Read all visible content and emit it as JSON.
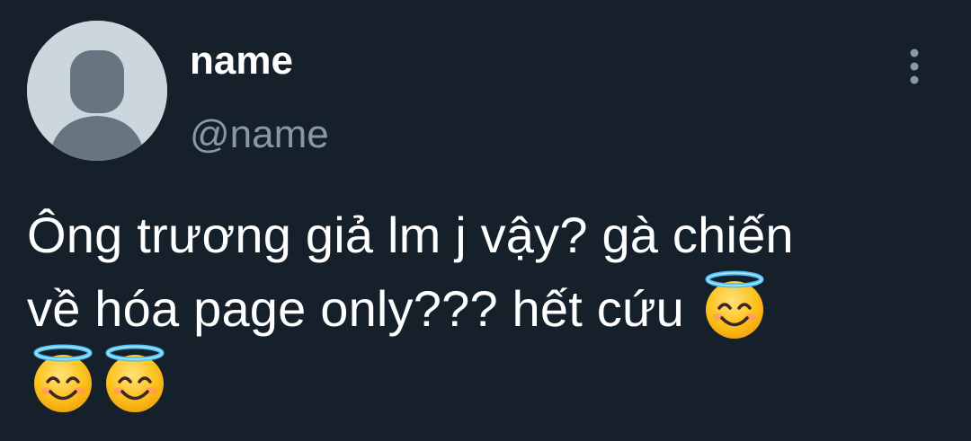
{
  "author": {
    "display_name": "name",
    "handle": "@name"
  },
  "tweet": {
    "line1": "Ông trương giả lm j vậy? gà chiến",
    "line2": "về hóa page only??? hết cứu"
  },
  "icons": {
    "more": "more-vertical-icon",
    "emoji": "smiling-face-with-halo-icon"
  },
  "colors": {
    "background": "#15202b",
    "text": "#ffffff",
    "secondary_text": "#8899a6",
    "avatar_bg": "#ccd6dd",
    "avatar_figure": "#66757f"
  }
}
